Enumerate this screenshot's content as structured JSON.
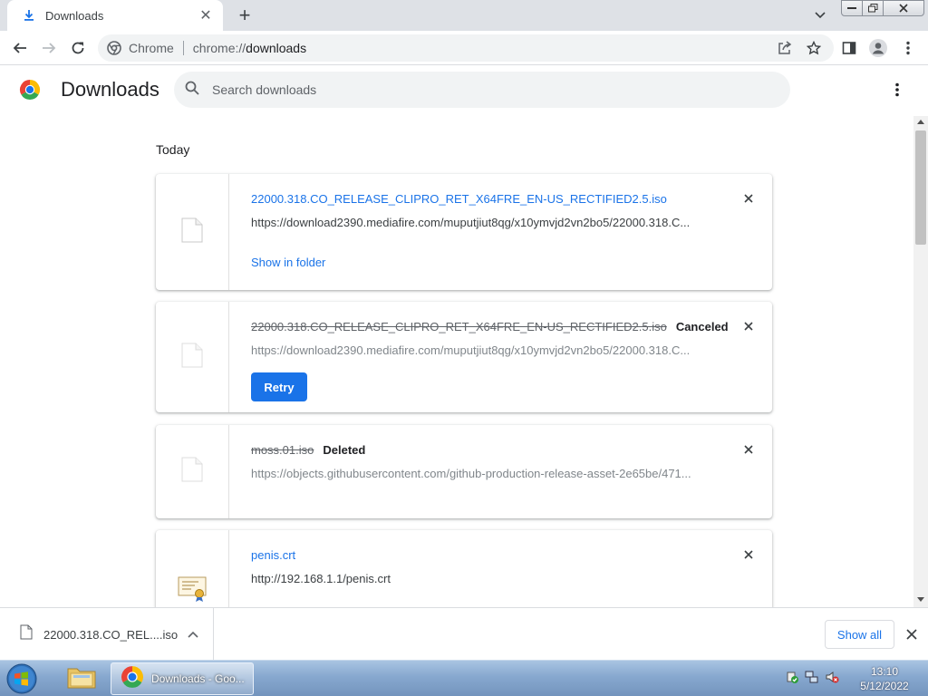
{
  "browser": {
    "tab_title": "Downloads",
    "omnibox_chip": "Chrome",
    "url_scheme": "chrome://",
    "url_path": "downloads"
  },
  "downloads_page": {
    "title": "Downloads",
    "search_placeholder": "Search downloads",
    "date_group": "Today",
    "items": [
      {
        "filename": "22000.318.CO_RELEASE_CLIPRO_RET_X64FRE_EN-US_RECTIFIED2.5.iso",
        "url": "https://download2390.mediafire.com/muputjiut8qg/x10ymvjd2vn2bo5/22000.318.C...",
        "action": "Show in folder",
        "status": ""
      },
      {
        "filename": "22000.318.CO_RELEASE_CLIPRO_RET_X64FRE_EN-US_RECTIFIED2.5.iso",
        "url": "https://download2390.mediafire.com/muputjiut8qg/x10ymvjd2vn2bo5/22000.318.C...",
        "action": "Retry",
        "status": "Canceled"
      },
      {
        "filename": "moss.01.iso",
        "url": "https://objects.githubusercontent.com/github-production-release-asset-2e65be/471...",
        "action": "",
        "status": "Deleted"
      },
      {
        "filename": "penis.crt",
        "url": "http://192.168.1.1/penis.crt",
        "action": "",
        "status": ""
      }
    ]
  },
  "shelf": {
    "item_label": "22000.318.CO_REL....iso",
    "show_all": "Show all"
  },
  "taskbar": {
    "chrome_label": "Downloads - Goo...",
    "time": "13:10",
    "date": "5/12/2022"
  },
  "colors": {
    "accent": "#1a73e8",
    "text": "#202124",
    "muted": "#5f6368"
  }
}
